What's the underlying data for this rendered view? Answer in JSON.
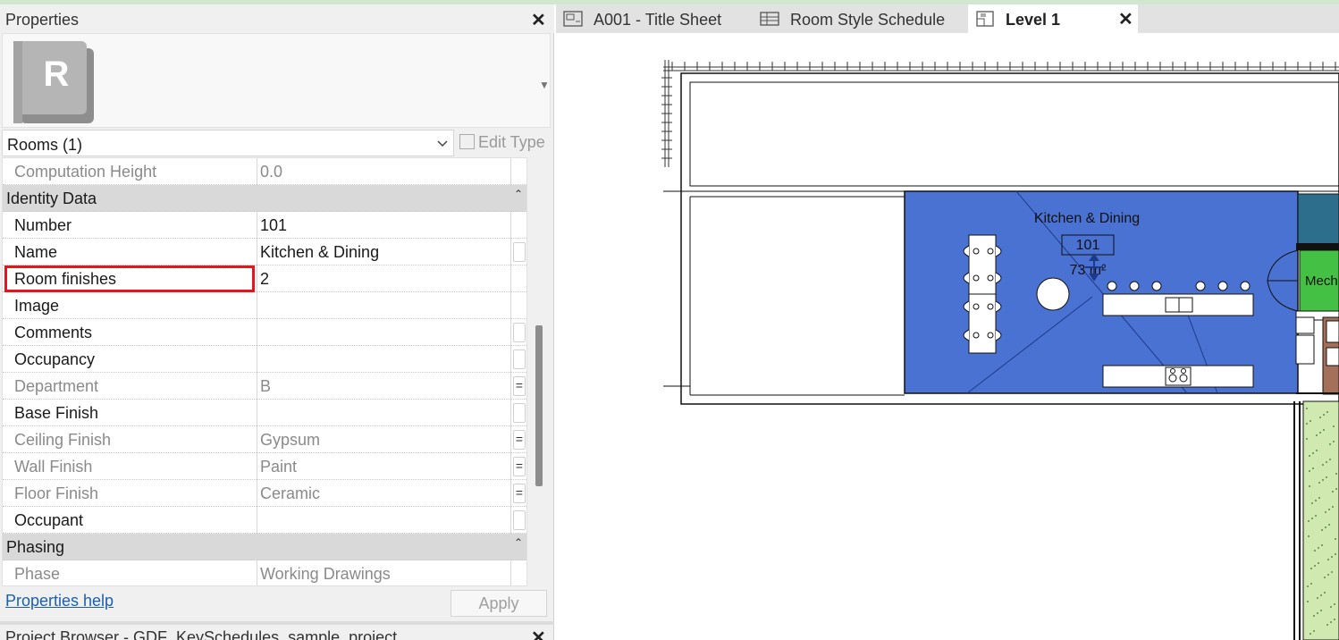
{
  "properties_panel": {
    "title": "Properties",
    "type_selector": "Rooms (1)",
    "edit_type_label": "Edit Type",
    "logo_letter": "R",
    "rows": [
      {
        "kind": "prop",
        "key": "Computation Height",
        "value": "0.0",
        "readonly": true,
        "button": ""
      },
      {
        "kind": "group",
        "key": "Identity Data"
      },
      {
        "kind": "prop",
        "key": "Number",
        "value": "101",
        "readonly": false,
        "button": ""
      },
      {
        "kind": "prop",
        "key": "Name",
        "value": "Kitchen & Dining",
        "readonly": false,
        "button": "box"
      },
      {
        "kind": "prop",
        "key": "Room finishes",
        "value": "2",
        "readonly": false,
        "button": ""
      },
      {
        "kind": "prop",
        "key": "Image",
        "value": "",
        "readonly": false,
        "button": ""
      },
      {
        "kind": "prop",
        "key": "Comments",
        "value": "",
        "readonly": false,
        "button": "box"
      },
      {
        "kind": "prop",
        "key": "Occupancy",
        "value": "",
        "readonly": false,
        "button": "box"
      },
      {
        "kind": "prop",
        "key": "Department",
        "value": "B",
        "readonly": true,
        "button": "="
      },
      {
        "kind": "prop",
        "key": "Base Finish",
        "value": "",
        "readonly": false,
        "button": "box"
      },
      {
        "kind": "prop",
        "key": "Ceiling Finish",
        "value": "Gypsum",
        "readonly": true,
        "button": "="
      },
      {
        "kind": "prop",
        "key": "Wall Finish",
        "value": "Paint",
        "readonly": true,
        "button": "="
      },
      {
        "kind": "prop",
        "key": "Floor Finish",
        "value": "Ceramic",
        "readonly": true,
        "button": "="
      },
      {
        "kind": "prop",
        "key": "Occupant",
        "value": "",
        "readonly": false,
        "button": "box"
      },
      {
        "kind": "group",
        "key": "Phasing"
      },
      {
        "kind": "prop",
        "key": "Phase",
        "value": "Working Drawings",
        "readonly": true,
        "button": ""
      }
    ],
    "highlighted_row": "Room finishes",
    "help_link": "Properties help",
    "apply_label": "Apply"
  },
  "project_browser": {
    "title": "Project Browser - GDF_KeySchedules_sample_project"
  },
  "tabs": [
    {
      "label": "A001 - Title Sheet",
      "icon": "sheet-icon",
      "active": false
    },
    {
      "label": "Room Style Schedule",
      "icon": "schedule-icon",
      "active": false
    },
    {
      "label": "Level 1",
      "icon": "floor-plan-icon",
      "active": true
    }
  ],
  "plan": {
    "room_name": "Kitchen & Dining",
    "room_number": "101",
    "room_area": "73 m²",
    "adjacent_room_label": "Mech",
    "room_fill_color": "#4a72d2",
    "mech_fill_color": "#44c144",
    "teal_fill_color": "#2d6e8c",
    "landscape_fill_color": "#cfe9b0",
    "highlight_color": "#e8141b"
  }
}
